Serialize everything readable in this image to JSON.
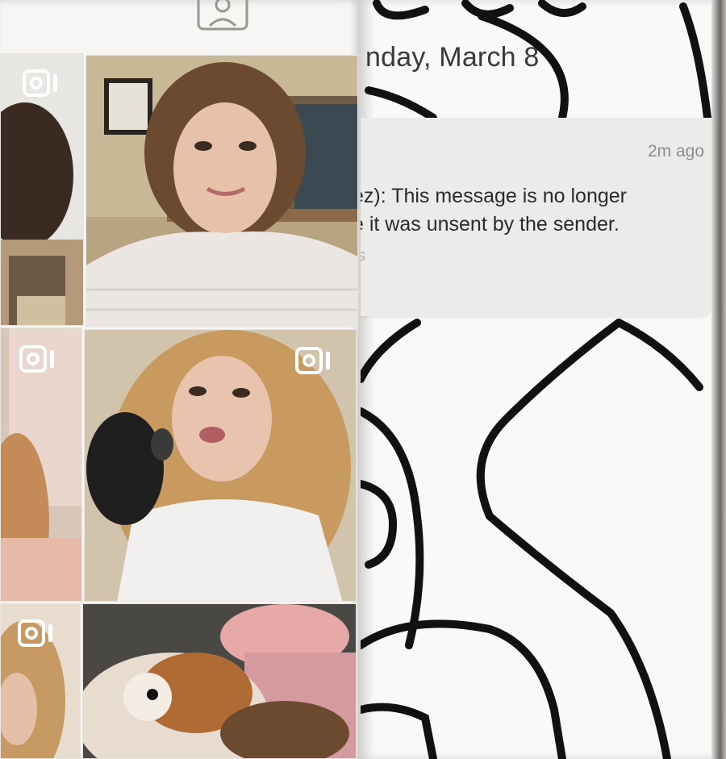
{
  "left_page": {
    "profile_icon": "person-tag-icon",
    "video_icon": "video-camera-icon",
    "photos": [
      {
        "name": "photo-selfie-short-hair",
        "has_video_icon": false
      },
      {
        "name": "photo-singing-microphone",
        "has_video_icon": true
      },
      {
        "name": "photo-guinea-pig",
        "has_video_icon": false
      }
    ]
  },
  "right_page": {
    "date": "nday, March 8",
    "notification": {
      "time": "2m ago",
      "line1": "ez): This message is no longer",
      "line2": "e it was unsent by the sender.",
      "sub": "s"
    }
  },
  "colors": {
    "outline": "#111111",
    "card": "#ecebea",
    "time_text": "#8e8e8e"
  }
}
